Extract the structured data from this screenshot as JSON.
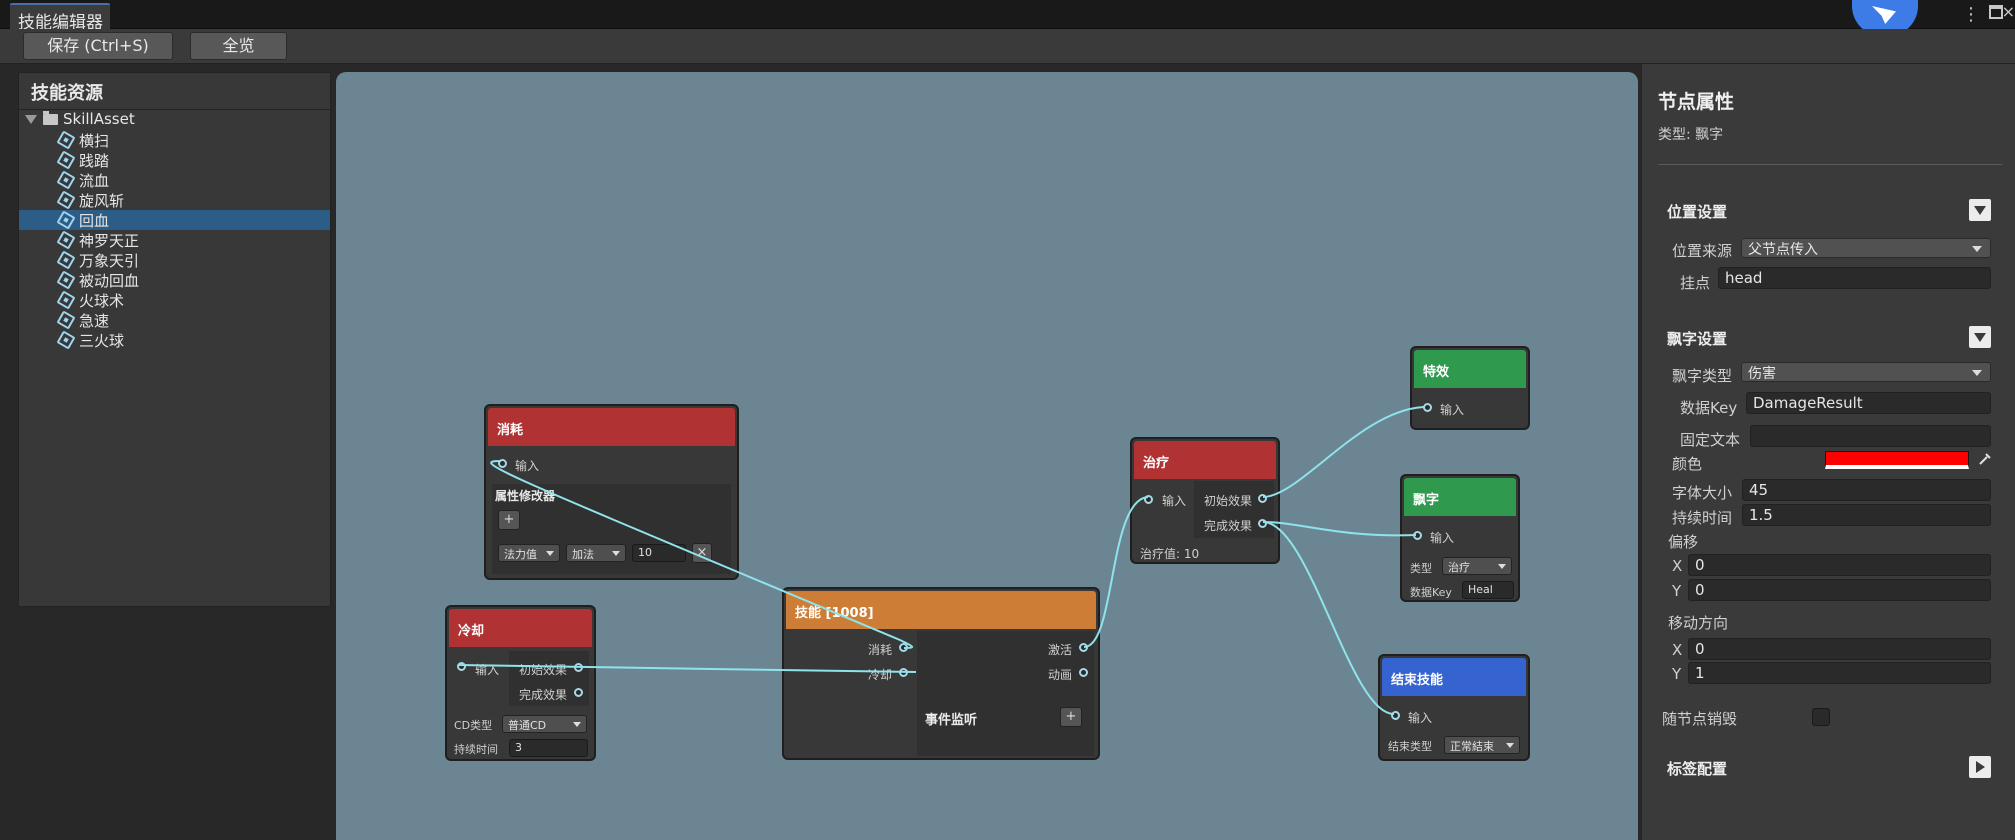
{
  "window": {
    "tab_label": "技能编辑器",
    "menu_glyph": "⋮",
    "close_glyph": "×"
  },
  "toolbar": {
    "save_label": "保存 (Ctrl+S)",
    "overview_label": "全览"
  },
  "assets": {
    "title": "技能资源",
    "root": "SkillAsset",
    "items": [
      "横扫",
      "践踏",
      "流血",
      "旋风斩",
      "回血",
      "神罗天正",
      "万象天引",
      "被动回血",
      "火球术",
      "急速",
      "三火球"
    ],
    "selected": "回血"
  },
  "nodes": {
    "consume": {
      "title": "消耗",
      "input": "输入",
      "section": "属性修改器",
      "add": "+",
      "attr": "法力值",
      "op": "加法",
      "value": "10",
      "remove": "×",
      "color": "#b03232"
    },
    "cooldown": {
      "title": "冷却",
      "input": "输入",
      "out_start": "初始效果",
      "out_done": "完成效果",
      "cd_type_label": "CD类型",
      "cd_type": "普通CD",
      "duration_label": "持续时间",
      "duration": "3",
      "color": "#b03232"
    },
    "skill": {
      "title": "技能 [1008]",
      "in_consume": "消耗",
      "in_cooldown": "冷却",
      "out_activate": "激活",
      "out_anim": "动画",
      "section": "事件监听",
      "add": "+",
      "color": "#cd7d35"
    },
    "heal": {
      "title": "治疗",
      "input": "输入",
      "out_start": "初始效果",
      "out_done": "完成效果",
      "value_text": "治疗值: 10",
      "color": "#b03232"
    },
    "effect": {
      "title": "特效",
      "input": "输入",
      "color": "#2f9a4e"
    },
    "float": {
      "title": "飘字",
      "input": "输入",
      "type_label": "类型",
      "type": "治疗",
      "key_label": "数据Key",
      "key": "Heal",
      "color": "#2f9a4e"
    },
    "end": {
      "title": "结束技能",
      "input": "输入",
      "end_type_label": "结束类型",
      "end_type": "正常結束",
      "color": "#3563cf"
    }
  },
  "inspector": {
    "title": "节点属性",
    "type_line": "类型: 飘字",
    "position": {
      "header": "位置设置",
      "source_label": "位置来源",
      "source_value": "父节点传入",
      "mount_label": "挂点",
      "mount_value": "head"
    },
    "float": {
      "header": "飘字设置",
      "type_label": "飘字类型",
      "type_value": "伤害",
      "key_label": "数据Key",
      "key_value": "DamageResult",
      "fixed_label": "固定文本",
      "fixed_value": "",
      "color_label": "颜色",
      "color_value": "#ff0000",
      "size_label": "字体大小",
      "size_value": "45",
      "duration_label": "持续时间",
      "duration_value": "1.5",
      "offset_label": "偏移",
      "offset_x": "0",
      "offset_y": "0",
      "move_label": "移动方向",
      "move_x": "0",
      "move_y": "1",
      "x_label": "X",
      "y_label": "Y"
    },
    "destroy_label": "随节点销毁",
    "tag_header": "标签配置"
  }
}
